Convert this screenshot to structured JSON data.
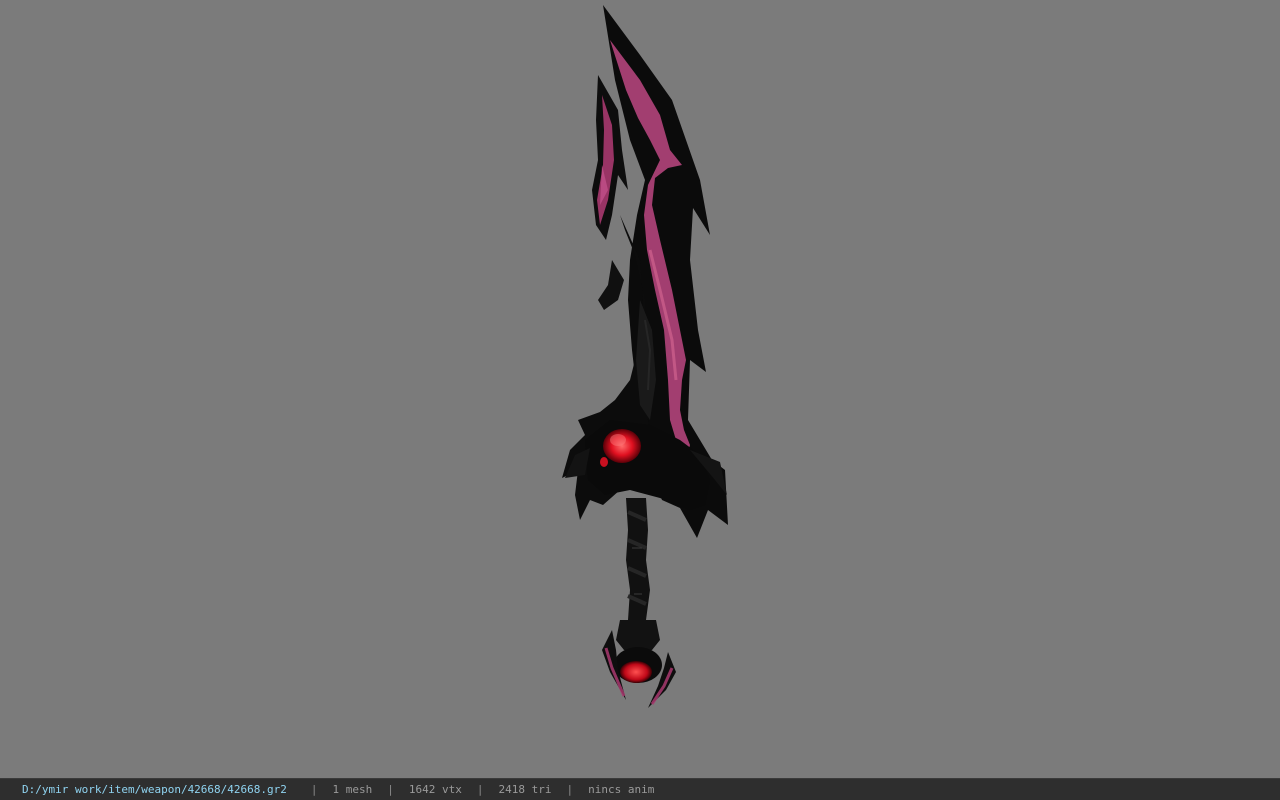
{
  "viewer": {
    "model_name": "sword-model",
    "background_color": "#7b7b7b",
    "colors": {
      "blade": "#0a0a0a",
      "accent": "#b2407a",
      "accent_light": "#d0638f",
      "gem": "#e01020",
      "gem_glow": "#ff4a4a"
    }
  },
  "status_bar": {
    "path": "D:/ymir work/item/weapon/42668/42668.gr2",
    "separator": "|",
    "mesh_count": "1 mesh",
    "vertex_count": "1642 vtx",
    "triangle_count": "2418 tri",
    "anim_status": "nincs anim"
  }
}
